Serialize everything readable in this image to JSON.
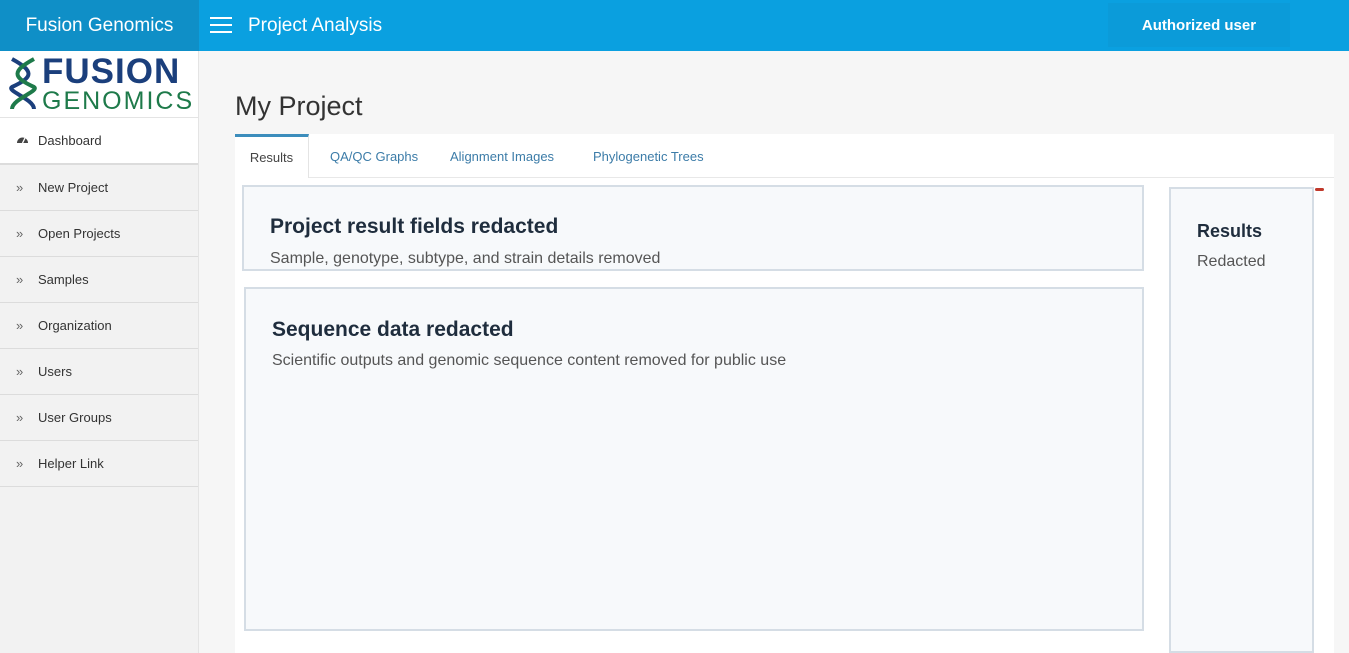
{
  "topbar": {
    "brand": "Fusion Genomics",
    "title": "Project Analysis",
    "user": "Authorized user"
  },
  "logo": {
    "line1": "FUSION",
    "line2": "GENOMICS"
  },
  "sidebar": {
    "items": [
      {
        "label": "Dashboard",
        "icon": "dashboard-icon"
      },
      {
        "label": "New Project",
        "icon": "chevron-double-right-icon"
      },
      {
        "label": "Open Projects",
        "icon": "chevron-double-right-icon"
      },
      {
        "label": "Samples",
        "icon": "chevron-double-right-icon"
      },
      {
        "label": "Organization",
        "icon": "chevron-double-right-icon"
      },
      {
        "label": "Users",
        "icon": "chevron-double-right-icon"
      },
      {
        "label": "User Groups",
        "icon": "chevron-double-right-icon"
      },
      {
        "label": "Helper Link",
        "icon": "chevron-double-right-icon"
      }
    ]
  },
  "page": {
    "title": "My Project",
    "tabs": [
      {
        "label": "Results",
        "active": true
      },
      {
        "label": "QA/QC Graphs",
        "active": false
      },
      {
        "label": "Alignment Images",
        "active": false
      },
      {
        "label": "Phylogenetic Trees",
        "active": false
      }
    ]
  },
  "cards": {
    "result": {
      "title": "Project result fields redacted",
      "subtitle": "Sample, genotype, subtype, and strain details removed"
    },
    "sequence": {
      "title": "Sequence data redacted",
      "subtitle": "Scientific outputs and genomic sequence content removed for public use"
    },
    "side": {
      "title": "Results",
      "subtitle": "Redacted"
    }
  },
  "colors": {
    "topbar": "#0aa0e0",
    "brand": "#0f8fc7",
    "accent": "#3c8dbc",
    "logo_blue": "#1b3f7c",
    "logo_green": "#1e7a4a"
  }
}
